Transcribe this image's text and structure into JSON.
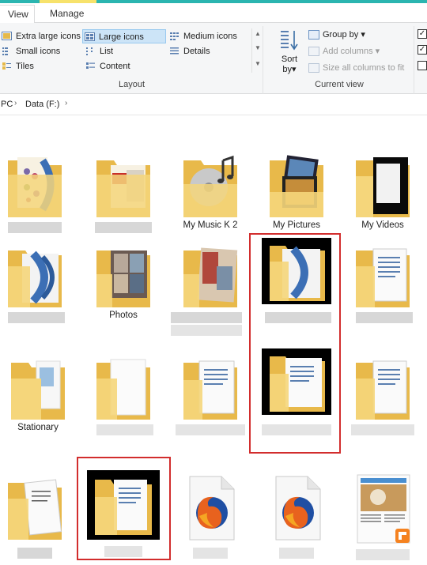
{
  "tabs": {
    "view": "View",
    "manage": "Manage"
  },
  "layout": {
    "items": [
      "Extra large icons",
      "Large icons",
      "Medium icons",
      "Small icons",
      "List",
      "Details",
      "Tiles",
      "Content"
    ],
    "selected": "Large icons",
    "group_label": "Layout"
  },
  "current_view": {
    "sort_label": "Sort\nby",
    "sort_line1": "Sort",
    "sort_line2": "by",
    "group_by": "Group by",
    "add_columns": "Add columns",
    "size_columns": "Size all columns to fit",
    "group_label": "Current view"
  },
  "address": {
    "pc": "PC",
    "drive": "Data (F:)"
  },
  "folders": {
    "music": "My Music K 2",
    "pictures": "My Pictures",
    "videos": "My Videos",
    "photos": "Photos",
    "stationary": "Stationary"
  },
  "icons": {
    "chevron": "›",
    "dropdown": "▾",
    "check": "✓",
    "scroll_up": "▲",
    "scroll_down": "▼"
  },
  "colors": {
    "accent": "#2bb5b0",
    "selection": "#cce4f7",
    "folder": "#f5d67b",
    "highlight_box": "#d22d2d"
  }
}
